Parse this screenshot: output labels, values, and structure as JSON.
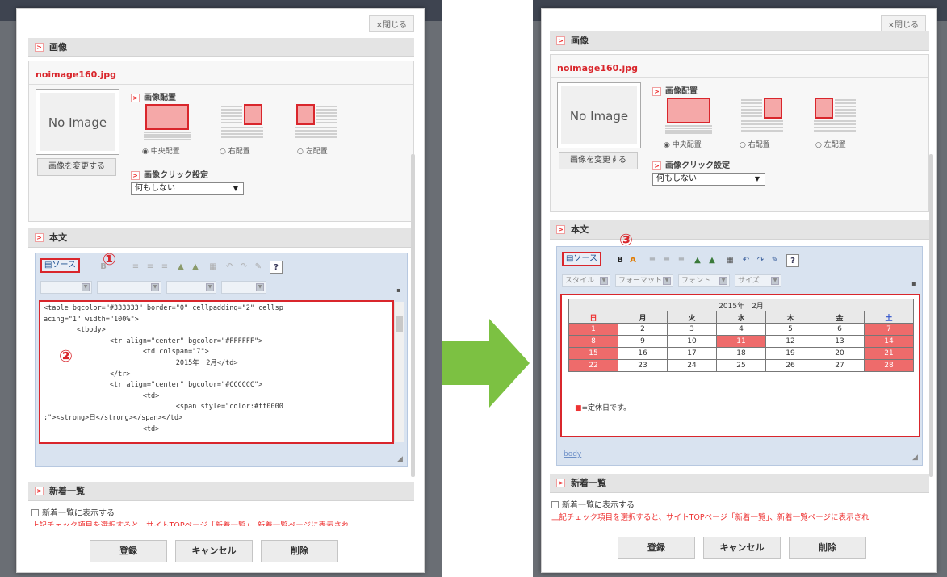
{
  "common": {
    "close_label": "×閉じる",
    "image_section": "画像",
    "file_name": "noimage160.jpg",
    "no_image_text": "No Image",
    "change_image_button": "画像を変更する",
    "layout_heading": "画像配置",
    "layout_options": [
      "中央配置",
      "右配置",
      "左配置"
    ],
    "click_setting_heading": "画像クリック設定",
    "click_setting_value": "何もしない",
    "body_section": "本文",
    "source_button": "ソース",
    "news_section": "新着一覧",
    "news_checkbox_label": "新着一覧に表示する",
    "news_notice": "上記チェック項目を選択すると、サイトTOPページ「新着一覧」、新着一覧ページに表示され",
    "buttons": {
      "register": "登録",
      "cancel": "キャンセル",
      "delete": "削除"
    }
  },
  "left": {
    "callout_1": "①",
    "callout_2": "②",
    "source_code": "<table bgcolor=\"#333333\" border=\"0\" cellpadding=\"2\" cellsp\nacing=\"1\" width=\"100%\">\n        <tbody>\n                <tr align=\"center\" bgcolor=\"#FFFFFF\">\n                        <td colspan=\"7\">\n                                2015年　2月</td>\n                </tr>\n                <tr align=\"center\" bgcolor=\"#CCCCCC\">\n                        <td>\n                                <span style=\"color:#ff0000\n;\"><strong>日</strong></span></td>\n                        <td>"
  },
  "right": {
    "callout_3": "③",
    "format_combos": [
      "スタイル",
      "フォーマット",
      "フォント",
      "サイズ"
    ],
    "calendar_title": "2015年　2月",
    "weekdays": [
      "日",
      "月",
      "火",
      "水",
      "木",
      "金",
      "土"
    ],
    "weeks": [
      [
        "1",
        "2",
        "3",
        "4",
        "5",
        "6",
        "7"
      ],
      [
        "8",
        "9",
        "10",
        "11",
        "12",
        "13",
        "14"
      ],
      [
        "15",
        "16",
        "17",
        "18",
        "19",
        "20",
        "21"
      ],
      [
        "22",
        "23",
        "24",
        "25",
        "26",
        "27",
        "28"
      ]
    ],
    "holiday_note": "=定休日です。",
    "holiday_mark": "■",
    "path_tag": "body"
  },
  "colors": {
    "accent_red": "#d9262c",
    "holiday_fill": "#ee6b6b",
    "arrow_green": "#7cc142"
  }
}
